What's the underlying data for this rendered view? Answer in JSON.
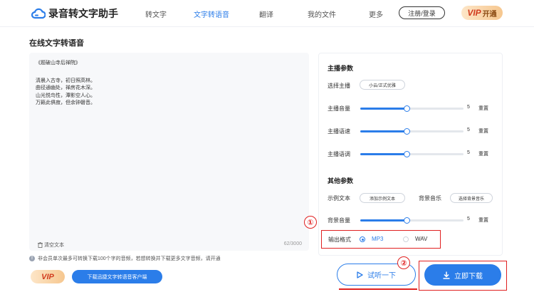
{
  "header": {
    "app_name": "录音转文字助手",
    "nav": [
      "转文字",
      "文字转语音",
      "翻译",
      "我的文件",
      "更多"
    ],
    "login_label": "注册/登录",
    "vip_label": "VIP",
    "vip_action": "开通"
  },
  "page_title": "在线文字转语音",
  "editor": {
    "lines": [
      "《题破山寺后禅院》",
      "清晨入古寺，初日照高林。",
      "曲径通幽处，禅房花木深。",
      "山光悦鸟性，潭影空人心。",
      "万籁此俱寂，但余钟磬音。"
    ],
    "clear_label": "清空文本",
    "counter": "62/3000"
  },
  "notice": "非会员单次最多可转换下载100个字的音频，若想转换并下载更多文字音频，请开通",
  "footer": {
    "vip_badge": "VIP",
    "client_download": "下载迅捷文字转语音客户端"
  },
  "panel": {
    "main_title": "主播参数",
    "select_anchor_label": "选择主播",
    "anchor_value": "小云/正式优雅",
    "sliders": [
      {
        "label": "主播音量",
        "value": "5",
        "fraction": 0.45
      },
      {
        "label": "主播语速",
        "value": "5",
        "fraction": 0.45
      },
      {
        "label": "主播语调",
        "value": "5",
        "fraction": 0.45
      }
    ],
    "reset_label": "重置",
    "other_title": "其他参数",
    "sample_text_label": "示例文本",
    "sample_text_btn": "添加示例文本",
    "bg_music_label": "背景音乐",
    "bg_music_btn": "选择背景音乐",
    "bg_volume": {
      "label": "背景音量",
      "value": "5",
      "fraction": 0.45
    },
    "format_label": "输出格式",
    "formats": [
      "MP3",
      "WAV"
    ],
    "selected_format": "MP3"
  },
  "actions": {
    "listen": "试听一下",
    "download": "立即下载"
  },
  "annotations": [
    "①",
    "②"
  ],
  "colors": {
    "accent": "#2b7de9",
    "annotation": "#e02020"
  }
}
